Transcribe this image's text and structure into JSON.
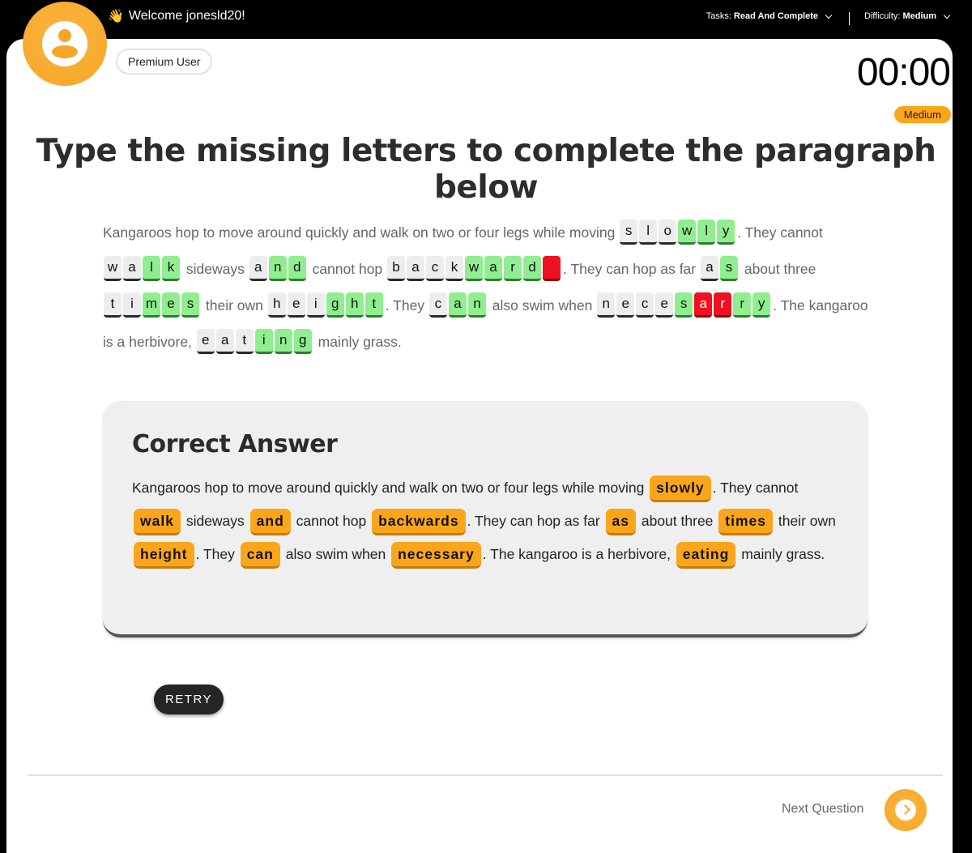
{
  "header": {
    "welcome_emoji": "👋",
    "welcome_text": "Welcome jonesld20!",
    "tasks_label": "Tasks:",
    "tasks_value": "Read And Complete",
    "difficulty_label": "Difficulty:",
    "difficulty_value": "Medium"
  },
  "user": {
    "badge": "Premium User"
  },
  "timer": "00:00",
  "difficulty_badge": "Medium",
  "title": "Type the missing letters to complete the paragraph below",
  "passage": [
    {
      "type": "text",
      "value": "Kangaroos hop to move around quickly and walk on two or four legs while moving "
    },
    {
      "type": "word",
      "letters": [
        [
          "s",
          "given"
        ],
        [
          "l",
          "given"
        ],
        [
          "o",
          "given"
        ],
        [
          "w",
          "correct"
        ],
        [
          "l",
          "correct"
        ],
        [
          "y",
          "correct"
        ]
      ]
    },
    {
      "type": "text",
      "value": ". They cannot "
    },
    {
      "type": "word",
      "letters": [
        [
          "w",
          "given"
        ],
        [
          "a",
          "given"
        ],
        [
          "l",
          "correct"
        ],
        [
          "k",
          "correct"
        ]
      ]
    },
    {
      "type": "text",
      "value": " sideways "
    },
    {
      "type": "word",
      "letters": [
        [
          "a",
          "given"
        ],
        [
          "n",
          "correct"
        ],
        [
          "d",
          "correct"
        ]
      ]
    },
    {
      "type": "text",
      "value": " cannot hop "
    },
    {
      "type": "word",
      "letters": [
        [
          "b",
          "given"
        ],
        [
          "a",
          "given"
        ],
        [
          "c",
          "given"
        ],
        [
          "k",
          "given"
        ],
        [
          "w",
          "correct"
        ],
        [
          "a",
          "correct"
        ],
        [
          "r",
          "correct"
        ],
        [
          "d",
          "correct"
        ],
        [
          "",
          "wrong"
        ]
      ]
    },
    {
      "type": "text",
      "value": ". They can hop as far "
    },
    {
      "type": "word",
      "letters": [
        [
          "a",
          "given"
        ],
        [
          "s",
          "correct"
        ]
      ]
    },
    {
      "type": "text",
      "value": " about three "
    },
    {
      "type": "word",
      "letters": [
        [
          "t",
          "given"
        ],
        [
          "i",
          "given"
        ],
        [
          "m",
          "correct"
        ],
        [
          "e",
          "correct"
        ],
        [
          "s",
          "correct"
        ]
      ]
    },
    {
      "type": "text",
      "value": " their own "
    },
    {
      "type": "word",
      "letters": [
        [
          "h",
          "given"
        ],
        [
          "e",
          "given"
        ],
        [
          "i",
          "given"
        ],
        [
          "g",
          "correct"
        ],
        [
          "h",
          "correct"
        ],
        [
          "t",
          "correct"
        ]
      ]
    },
    {
      "type": "text",
      "value": ". They "
    },
    {
      "type": "word",
      "letters": [
        [
          "c",
          "given"
        ],
        [
          "a",
          "correct"
        ],
        [
          "n",
          "correct"
        ]
      ]
    },
    {
      "type": "text",
      "value": " also swim when "
    },
    {
      "type": "word",
      "letters": [
        [
          "n",
          "given"
        ],
        [
          "e",
          "given"
        ],
        [
          "c",
          "given"
        ],
        [
          "e",
          "given"
        ],
        [
          "s",
          "correct"
        ],
        [
          "a",
          "wrong"
        ],
        [
          "r",
          "wrong"
        ],
        [
          "r",
          "correct"
        ],
        [
          "y",
          "correct"
        ]
      ]
    },
    {
      "type": "text",
      "value": ". The kangaroo is a herbivore, "
    },
    {
      "type": "word",
      "letters": [
        [
          "e",
          "given"
        ],
        [
          "a",
          "given"
        ],
        [
          "t",
          "given"
        ],
        [
          "i",
          "correct"
        ],
        [
          "n",
          "correct"
        ],
        [
          "g",
          "correct"
        ]
      ]
    },
    {
      "type": "text",
      "value": " mainly grass."
    }
  ],
  "correct_answer": {
    "title": "Correct Answer",
    "segments": [
      {
        "type": "text",
        "value": "Kangaroos hop to move around quickly and walk on two or four legs while moving "
      },
      {
        "type": "chip",
        "value": "slowly"
      },
      {
        "type": "text",
        "value": ". They cannot "
      },
      {
        "type": "chip",
        "value": "walk"
      },
      {
        "type": "text",
        "value": " sideways "
      },
      {
        "type": "chip",
        "value": "and"
      },
      {
        "type": "text",
        "value": " cannot hop "
      },
      {
        "type": "chip",
        "value": "backwards"
      },
      {
        "type": "text",
        "value": ". They can hop as far "
      },
      {
        "type": "chip",
        "value": "as"
      },
      {
        "type": "text",
        "value": " about three "
      },
      {
        "type": "chip",
        "value": "times"
      },
      {
        "type": "text",
        "value": " their own "
      },
      {
        "type": "chip",
        "value": "height"
      },
      {
        "type": "text",
        "value": ". They "
      },
      {
        "type": "chip",
        "value": "can"
      },
      {
        "type": "text",
        "value": " also swim when "
      },
      {
        "type": "chip",
        "value": "necessary"
      },
      {
        "type": "text",
        "value": ". The kangaroo is a herbivore, "
      },
      {
        "type": "chip",
        "value": "eating"
      },
      {
        "type": "text",
        "value": " mainly grass."
      }
    ]
  },
  "buttons": {
    "retry": "RETRY",
    "next_question": "Next Question"
  },
  "colors": {
    "accent": "#f6a623",
    "correct": "#90ee90",
    "wrong": "#ee1122",
    "chip": "#fba61a"
  }
}
